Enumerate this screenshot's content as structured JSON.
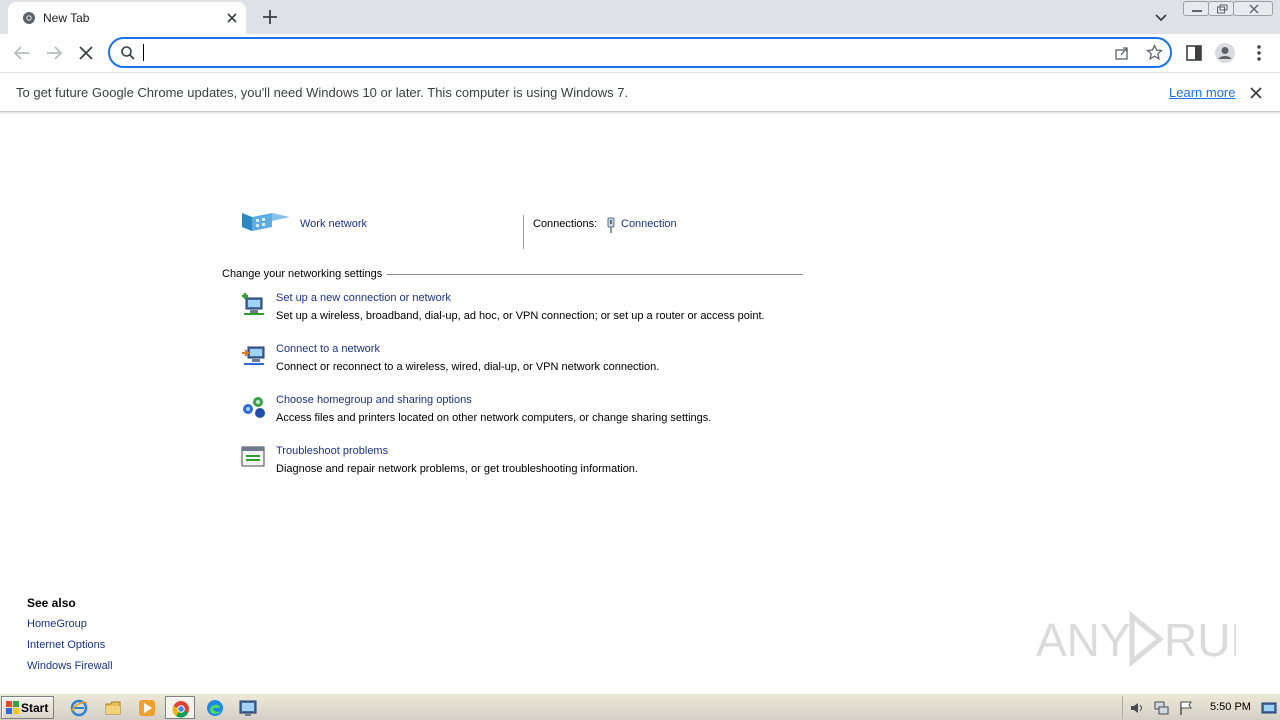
{
  "browser": {
    "tab": {
      "title": "New Tab"
    },
    "omnibox": {
      "value": "",
      "placeholder": ""
    },
    "infobar": {
      "message": "To get future Google Chrome updates, you'll need Windows 10 or later. This computer is using Windows 7.",
      "link": "Learn more"
    },
    "accent_color": "#1a73e8"
  },
  "network": {
    "network_name": "Work network",
    "connections_label": "Connections:",
    "connection_name": "Connection"
  },
  "settings": {
    "title": "Change your networking settings",
    "tasks": [
      {
        "link": "Set up a new connection or network",
        "desc": "Set up a wireless, broadband, dial-up, ad hoc, or VPN connection; or set up a router or access point.",
        "icon": "new-connection-icon"
      },
      {
        "link": "Connect to a network",
        "desc": "Connect or reconnect to a wireless, wired, dial-up, or VPN network connection.",
        "icon": "connect-network-icon"
      },
      {
        "link": "Choose homegroup and sharing options",
        "desc": "Access files and printers located on other network computers, or change sharing settings.",
        "icon": "homegroup-icon"
      },
      {
        "link": "Troubleshoot problems",
        "desc": "Diagnose and repair network problems, or get troubleshooting information.",
        "icon": "troubleshoot-icon"
      }
    ]
  },
  "see_also": {
    "title": "See also",
    "links": [
      "HomeGroup",
      "Internet Options",
      "Windows Firewall"
    ]
  },
  "watermark": {
    "text": "ANY RUN"
  },
  "taskbar": {
    "start_label": "Start",
    "clock": "5:50 PM",
    "apps": [
      "internet-explorer-icon",
      "explorer-icon",
      "media-player-icon",
      "chrome-icon",
      "edge-icon",
      "control-panel-icon"
    ]
  }
}
